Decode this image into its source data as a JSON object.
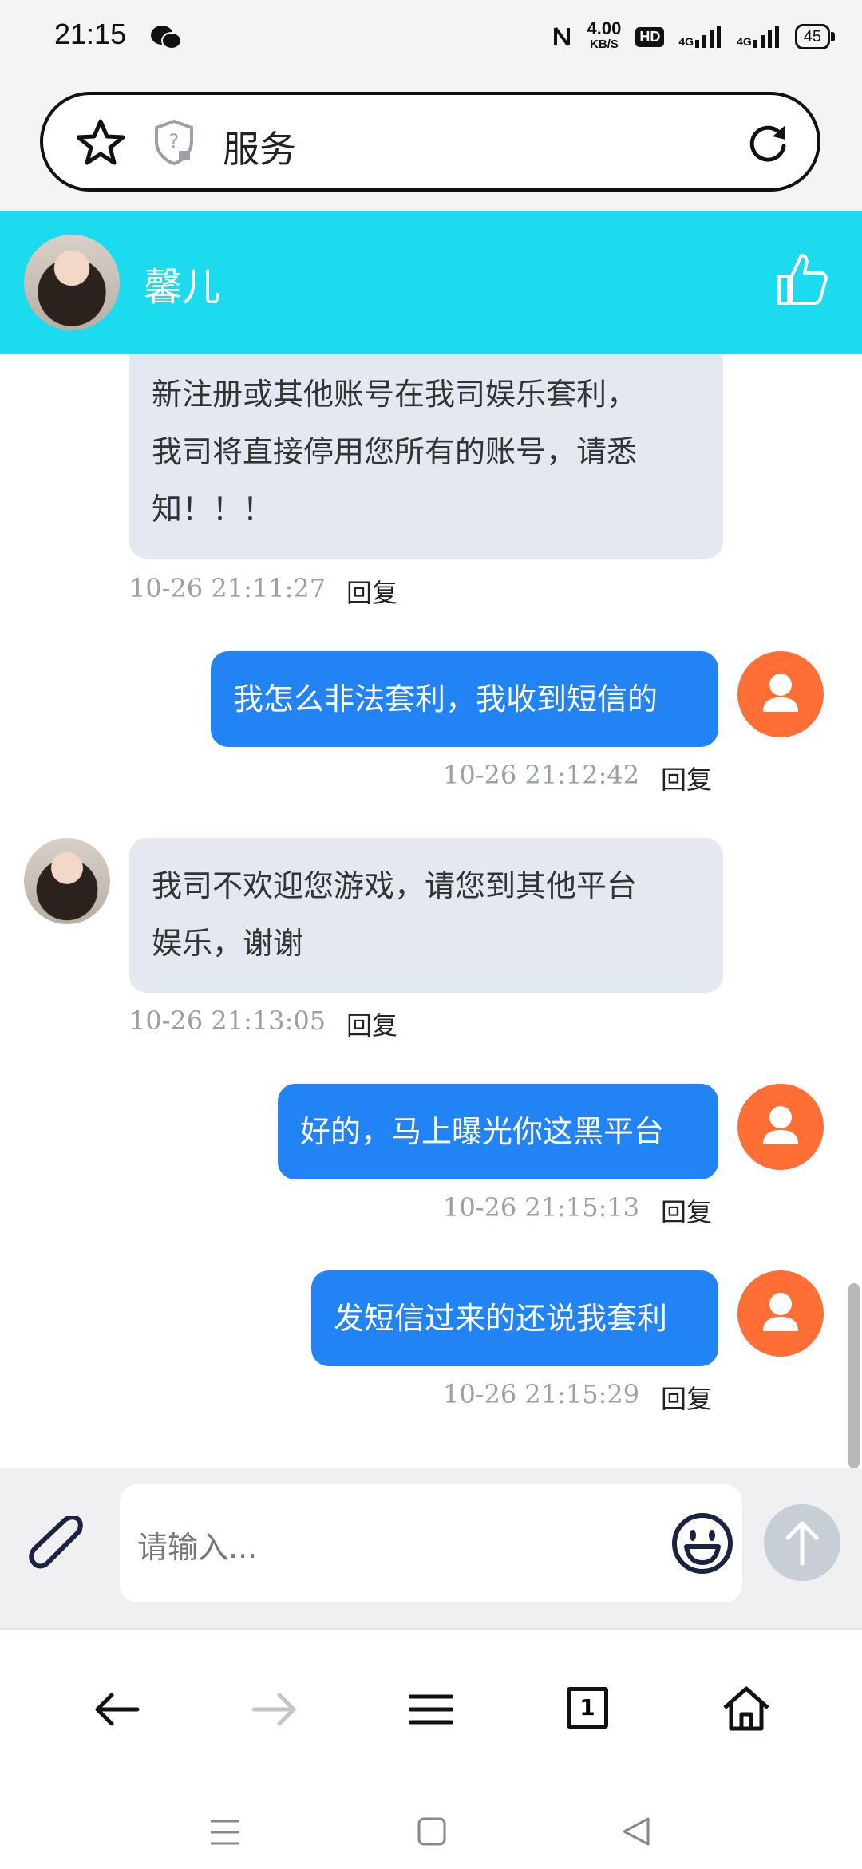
{
  "status_bar": {
    "time": "21:15",
    "net_speed_value": "4.00",
    "net_speed_unit": "KB/S",
    "hd_label": "HD",
    "sig1_label": "4G",
    "sig2_label": "4G",
    "battery": "45"
  },
  "address_bar": {
    "title": "服务"
  },
  "chat_header": {
    "contact_name": "馨儿"
  },
  "messages": [
    {
      "side": "in",
      "lines": [
        "新注册或其他账号在我司娱乐套利，",
        "我司将直接停用您所有的账号，请悉",
        "知！！！"
      ],
      "timestamp": "10-26 21:11:27",
      "reply": "回复"
    },
    {
      "side": "out",
      "text": "我怎么非法套利，我收到短信的",
      "timestamp": "10-26 21:12:42",
      "reply": "回复"
    },
    {
      "side": "in",
      "lines": [
        "我司不欢迎您游戏，请您到其他平台",
        "娱乐，谢谢"
      ],
      "timestamp": "10-26 21:13:05",
      "reply": "回复"
    },
    {
      "side": "out",
      "text": "好的，马上曝光你这黑平台",
      "timestamp": "10-26 21:15:13",
      "reply": "回复"
    },
    {
      "side": "out",
      "text": "发短信过来的还说我套利",
      "timestamp": "10-26 21:15:29",
      "reply": "回复"
    }
  ],
  "input": {
    "placeholder": "请输入..."
  },
  "browser_nav": {
    "tab_count": "1"
  },
  "colors": {
    "header_bg": "#1ddbee",
    "outgoing_bubble": "#2283f5",
    "incoming_bubble": "#e3e8f1",
    "user_avatar": "#ff6e35"
  },
  "icons": [
    "star-icon",
    "shield-icon",
    "refresh-icon",
    "thumbs-up-icon",
    "user-icon",
    "paperclip-icon",
    "emoji-icon",
    "send-arrow-icon",
    "back-arrow-icon",
    "forward-arrow-icon",
    "menu-icon",
    "tabs-icon",
    "home-icon"
  ]
}
